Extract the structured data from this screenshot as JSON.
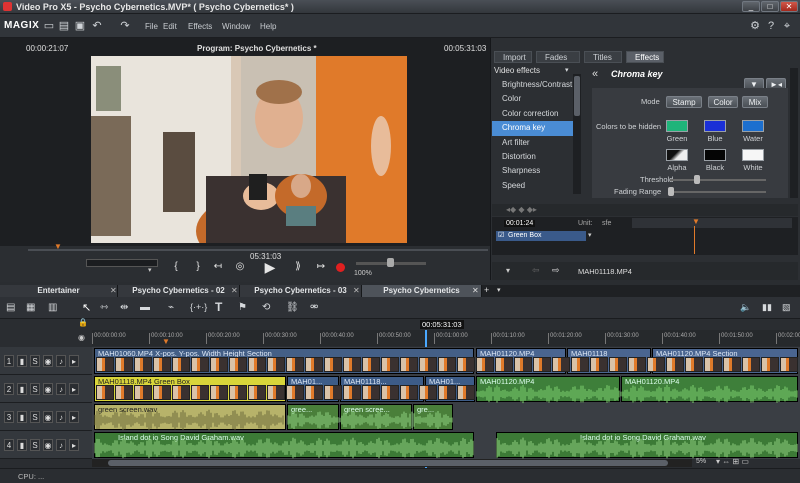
{
  "window": {
    "title": "Video Pro X5 - Psycho Cybernetics.MVP* ( Psycho Cybernetics* )",
    "min": "_",
    "max": "□",
    "close": "✕"
  },
  "app": {
    "logo": "MAGIX",
    "menus": [
      "File",
      "Edit",
      "Effects",
      "Window",
      "Help"
    ]
  },
  "monitor": {
    "time_left": "00:00:21:07",
    "title": "Program: Psycho Cybernetics *",
    "time_right": "00:05:31:03",
    "position": "05:31:03",
    "zoom": "100%"
  },
  "right_panel": {
    "tabs": [
      "Import",
      "Fades",
      "Titles",
      "Effects"
    ],
    "active_tab": "Effects",
    "category": "Video effects",
    "effects": [
      "Brightness/Contrast",
      "Color",
      "Color correction",
      "Chroma key",
      "Art filter",
      "Distortion",
      "Sharpness",
      "Speed"
    ],
    "selected_effect": "Chroma key",
    "panel_title": "Chroma key",
    "mode_label": "Mode",
    "mode_buttons": [
      "Stamp",
      "Color",
      "Mix"
    ],
    "colors_label": "Colors to be hidden",
    "swatches": [
      {
        "label": "Green",
        "color": "#1fb47a"
      },
      {
        "label": "Blue",
        "color": "#1a2fd6"
      },
      {
        "label": "Water",
        "color": "#1c6fcf"
      },
      {
        "label": "Alpha",
        "color": "#e8e8e8"
      },
      {
        "label": "Black",
        "color": "#050505"
      },
      {
        "label": "White",
        "color": "#f6f6f6"
      }
    ],
    "threshold_label": "Threshold",
    "fading_label": "Fading Range",
    "kf_time": "00:01:24",
    "kf_unit": "Unit:",
    "kf_unit_val": "sfe",
    "kf_track": "Green Box",
    "clip_name": "MAH01118.MP4"
  },
  "project_tabs": [
    "Entertainer",
    "Psycho Cybernetics - 02",
    "Psycho Cybernetics - 03",
    "Psycho Cybernetics"
  ],
  "active_project_tab": "Psycho Cybernetics",
  "timeline": {
    "cursor_time": "00:05:31:03",
    "ruler_ticks": [
      "00:00:00:00",
      "00:00:10:00",
      "00:00:20:00",
      "00:00:30:00",
      "00:00:40:00",
      "00:00:50:00",
      "00:01:00:00",
      "00:01:10:00",
      "00:01:20:00",
      "00:01:30:00",
      "00:01:40:00",
      "00:01:50:00",
      "00:02:00:00"
    ],
    "tracks": [
      {
        "num": "1",
        "s": "S"
      },
      {
        "num": "2",
        "s": "S"
      },
      {
        "num": "3",
        "s": "S"
      },
      {
        "num": "4",
        "s": "S"
      }
    ],
    "clips": {
      "t1a": "MAH01060.MP4  X-pos. Y-pos. Width Height Section",
      "t1b": "MAH01120.MP4",
      "t1c": "MAH01118",
      "t1d": "MAH01120.MP4  Section",
      "t2a": "MAH01118.MP4 Green Box",
      "t2b": "MAH01...",
      "t2c": "MAH01118...",
      "t2d": "MAH01...",
      "t2e": "MAH01120.MP4",
      "t2f": "MAH01120.MP4",
      "t3a": "green screen.wav",
      "t3b": "gree...",
      "t3c": "green scree...",
      "t3d": "gre...",
      "t4a": "Island dot io Song David Graham.wav",
      "t4b": "Island dot io Song David Graham.wav"
    },
    "zoom": "5%"
  },
  "status": {
    "cpu": "CPU: ..."
  }
}
